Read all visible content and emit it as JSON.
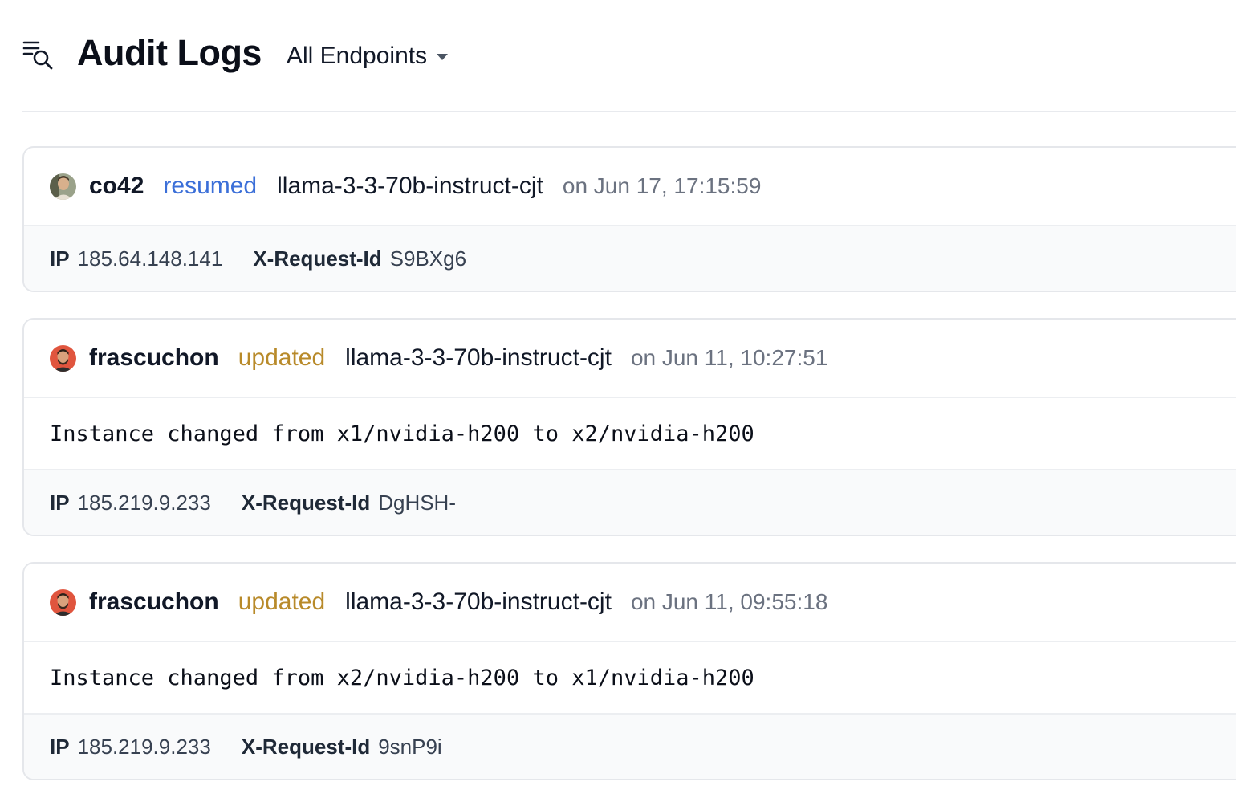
{
  "header": {
    "title": "Audit Logs",
    "endpoint_filter": "All Endpoints",
    "icon": "list-search-icon"
  },
  "logs": [
    {
      "user": "co42",
      "action": "resumed",
      "target": "llama-3-3-70b-instruct-cjt",
      "time": "on Jun 17, 17:15:59",
      "message": "",
      "ip_label": "IP",
      "ip": "185.64.148.141",
      "request_label": "X-Request-Id",
      "request_id": "S9BXg6"
    },
    {
      "user": "frascuchon",
      "action": "updated",
      "target": "llama-3-3-70b-instruct-cjt",
      "time": "on Jun 11, 10:27:51",
      "message": "Instance changed from x1/nvidia-h200 to x2/nvidia-h200",
      "ip_label": "IP",
      "ip": "185.219.9.233",
      "request_label": "X-Request-Id",
      "request_id": "DgHSH-"
    },
    {
      "user": "frascuchon",
      "action": "updated",
      "target": "llama-3-3-70b-instruct-cjt",
      "time": "on Jun 11, 09:55:18",
      "message": "Instance changed from x2/nvidia-h200 to x1/nvidia-h200",
      "ip_label": "IP",
      "ip": "185.219.9.233",
      "request_label": "X-Request-Id",
      "request_id": "9snP9i"
    }
  ],
  "colors": {
    "resumed": "#3b6fd8",
    "updated": "#b88a2a",
    "muted": "#6b7280"
  }
}
